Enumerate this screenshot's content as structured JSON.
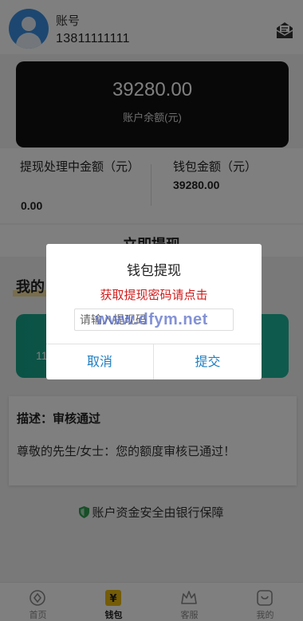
{
  "header": {
    "account_label": "账号",
    "phone": "13811111111"
  },
  "balance_card": {
    "amount": "39280.00",
    "label": "账户余额(元)"
  },
  "stats": {
    "processing_title": "提现处理中金额（元）",
    "processing_value": "0.00",
    "wallet_title": "钱包金额（元）",
    "wallet_value": "39280.00"
  },
  "withdraw_strip": {
    "label": "立即提现"
  },
  "section": {
    "title": "我的"
  },
  "green_card": {
    "partial_number": "11"
  },
  "description": {
    "title": "描述：审核通过",
    "text": "尊敬的先生/女士：您的额度审核已通过！"
  },
  "safety_note": "账户资金安全由银行保障",
  "tabbar": {
    "items": [
      {
        "label": "首页",
        "icon": "home-icon"
      },
      {
        "label": "钱包",
        "icon": "wallet-icon"
      },
      {
        "label": "客服",
        "icon": "service-icon"
      },
      {
        "label": "我的",
        "icon": "profile-icon"
      }
    ],
    "active_index": 1
  },
  "modal": {
    "title": "钱包提现",
    "link_text": "获取提现密码请点击",
    "input_placeholder": "请输入提现码",
    "cancel_label": "取消",
    "submit_label": "提交"
  },
  "watermark": "www.dfym.net",
  "colors": {
    "accent": "#1e7fc2",
    "link_red": "#d11b1b",
    "card_dark": "#111111",
    "card_green": "#17a58b"
  }
}
